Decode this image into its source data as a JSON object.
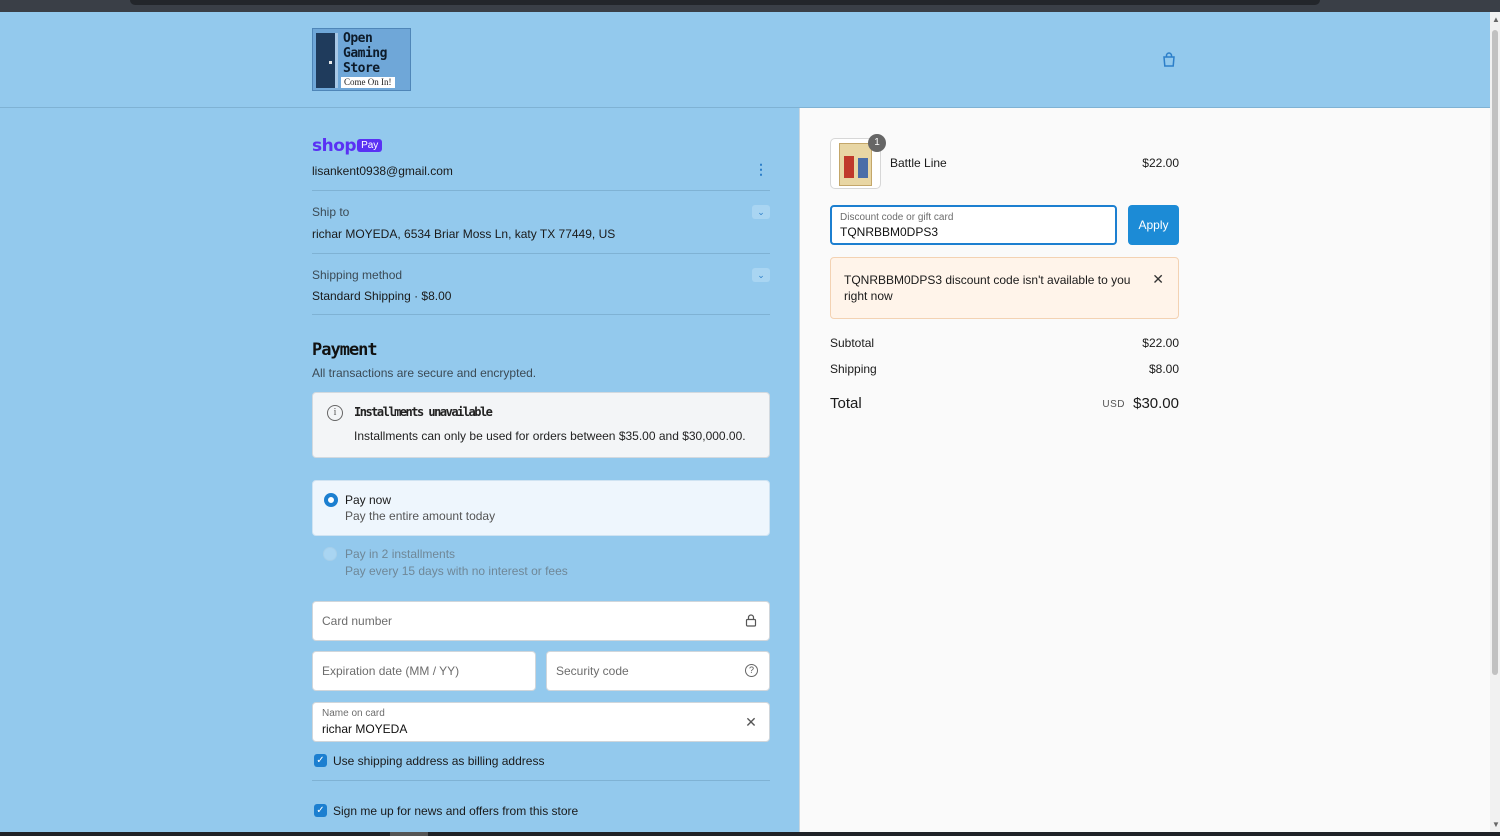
{
  "header": {
    "logo_line1": "Open",
    "logo_line2": "Gaming",
    "logo_line3": "Store",
    "logo_tagline": "Come On In!"
  },
  "shop_pay": {
    "brand": "shop",
    "badge": "Pay",
    "email": "lisankent0938@gmail.com"
  },
  "ship_to": {
    "label": "Ship to",
    "value": "richar MOYEDA, 6534 Briar Moss Ln, katy TX 77449, US"
  },
  "shipping_method": {
    "label": "Shipping method",
    "value": "Standard Shipping · $8.00"
  },
  "payment": {
    "title": "Payment",
    "subtitle": "All transactions are secure and encrypted.",
    "notice_title": "Installments unavailable",
    "notice_text": "Installments can only be used for orders between $35.00 and $30,000.00.",
    "options": [
      {
        "title": "Pay now",
        "subtitle": "Pay the entire amount today",
        "selected": true
      },
      {
        "title": "Pay in 2 installments",
        "subtitle": "Pay every 15 days with no interest or fees",
        "selected": false
      }
    ],
    "card_number_placeholder": "Card number",
    "expiration_placeholder": "Expiration date (MM / YY)",
    "security_placeholder": "Security code",
    "name_label": "Name on card",
    "name_value": "richar MOYEDA",
    "billing_checkbox": "Use shipping address as billing address",
    "newsletter_checkbox": "Sign me up for news and offers from this store"
  },
  "summary": {
    "item_name": "Battle Line",
    "item_price": "$22.00",
    "item_qty": "1",
    "discount_label": "Discount code or gift card",
    "discount_value": "TQNRBBM0DPS3",
    "apply_label": "Apply",
    "error_text": "TQNRBBM0DPS3 discount code isn't available to you right now",
    "subtotal_label": "Subtotal",
    "subtotal_value": "$22.00",
    "shipping_label": "Shipping",
    "shipping_value": "$8.00",
    "total_label": "Total",
    "total_currency": "USD",
    "total_value": "$30.00"
  },
  "colors": {
    "accent": "#1c7fd0",
    "header_bg": "#93c9ed",
    "shop_pay": "#5a31f4"
  }
}
